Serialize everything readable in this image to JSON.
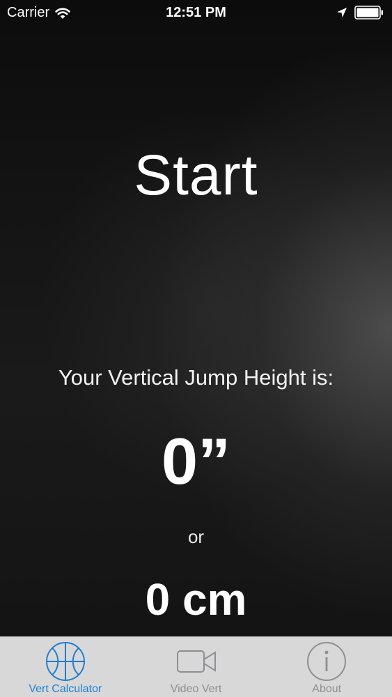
{
  "status_bar": {
    "carrier": "Carrier",
    "time": "12:51 PM",
    "icons": [
      "wifi-icon",
      "location-arrow-icon",
      "battery-icon"
    ]
  },
  "main": {
    "start_label": "Start",
    "result_label": "Your Vertical Jump Height is:",
    "inches_value": "0”",
    "or_label": "or",
    "cm_value": "0 cm"
  },
  "tab_bar": {
    "active_color": "#1d7fd6",
    "inactive_color": "#8e8e93",
    "tabs": [
      {
        "label": "Vert Calculator",
        "icon": "basketball-icon",
        "active": true
      },
      {
        "label": "Video Vert",
        "icon": "video-camera-icon",
        "active": false
      },
      {
        "label": "About",
        "icon": "info-icon",
        "active": false
      }
    ]
  }
}
